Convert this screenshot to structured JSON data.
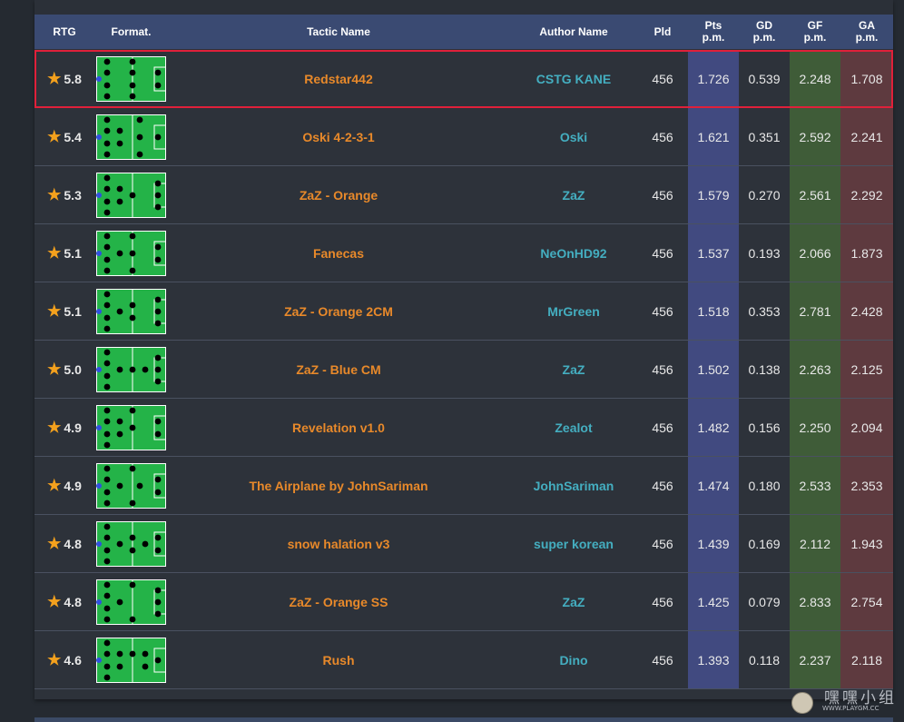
{
  "header": {
    "rtg": "RTG",
    "format": "Format.",
    "tactic_name": "Tactic Name",
    "author_name": "Author Name",
    "pld": "Pld",
    "pts_line1": "Pts",
    "pts_line2": "p.m.",
    "gd_line1": "GD",
    "gd_line2": "p.m.",
    "gf_line1": "GF",
    "gf_line2": "p.m.",
    "ga_line1": "GA",
    "ga_line2": "p.m."
  },
  "rows": [
    {
      "rating": "5.8",
      "tactic": "Redstar442",
      "author": "CSTG KANE",
      "pld": "456",
      "pts": "1.726",
      "gd": "0.539",
      "gf": "2.248",
      "ga": "1.708",
      "formation": "4-4-2"
    },
    {
      "rating": "5.4",
      "tactic": "Oski 4-2-3-1",
      "author": "Oski",
      "pld": "456",
      "pts": "1.621",
      "gd": "0.351",
      "gf": "2.592",
      "ga": "2.241",
      "formation": "4-2-3-1"
    },
    {
      "rating": "5.3",
      "tactic": "ZaZ - Orange",
      "author": "ZaZ",
      "pld": "456",
      "pts": "1.579",
      "gd": "0.270",
      "gf": "2.561",
      "ga": "2.292",
      "formation": "4-2-1-3"
    },
    {
      "rating": "5.1",
      "tactic": "Fanecas",
      "author": "NeOnHD92",
      "pld": "456",
      "pts": "1.537",
      "gd": "0.193",
      "gf": "2.066",
      "ga": "1.873",
      "formation": "4-3-1-2"
    },
    {
      "rating": "5.1",
      "tactic": "ZaZ - Orange 2CM",
      "author": "MrGreen",
      "pld": "456",
      "pts": "1.518",
      "gd": "0.353",
      "gf": "2.781",
      "ga": "2.428",
      "formation": "4-1-2-3"
    },
    {
      "rating": "5.0",
      "tactic": "ZaZ - Blue CM",
      "author": "ZaZ",
      "pld": "456",
      "pts": "1.502",
      "gd": "0.138",
      "gf": "2.263",
      "ga": "2.125",
      "formation": "4-1-2-3b"
    },
    {
      "rating": "4.9",
      "tactic": "Revelation v1.0",
      "author": "Zealot",
      "pld": "456",
      "pts": "1.482",
      "gd": "0.156",
      "gf": "2.250",
      "ga": "2.094",
      "formation": "4-2-2-2"
    },
    {
      "rating": "4.9",
      "tactic": "The Airplane by JohnSariman",
      "author": "JohnSariman",
      "pld": "456",
      "pts": "1.474",
      "gd": "0.180",
      "gf": "2.533",
      "ga": "2.353",
      "formation": "4-3-3"
    },
    {
      "rating": "4.8",
      "tactic": "snow halation v3",
      "author": "super korean",
      "pld": "456",
      "pts": "1.439",
      "gd": "0.169",
      "gf": "2.112",
      "ga": "1.943",
      "formation": "4-1-3-2"
    },
    {
      "rating": "4.8",
      "tactic": "ZaZ - Orange SS",
      "author": "ZaZ",
      "pld": "456",
      "pts": "1.425",
      "gd": "0.079",
      "gf": "2.833",
      "ga": "2.754",
      "formation": "4-1-2-3c"
    },
    {
      "rating": "4.6",
      "tactic": "Rush",
      "author": "Dino",
      "pld": "456",
      "pts": "1.393",
      "gd": "0.118",
      "gf": "2.237",
      "ga": "2.118",
      "formation": "4-2-2-2b"
    }
  ],
  "icons": {
    "rating_star": "star-icon",
    "formation": "pitch-icon"
  },
  "colors": {
    "tactic_name": "#e8892a",
    "author_name": "#44aec0",
    "pts_col": "#414a80",
    "gf_col": "#3f5c38",
    "ga_col": "#5e3a3f",
    "pitch": "#24b348",
    "highlight": "#e0203a",
    "star": "#f4a11d"
  },
  "watermark": {
    "text": "嘿嘿小组",
    "site": "WWW.PLAYGM.CC"
  }
}
